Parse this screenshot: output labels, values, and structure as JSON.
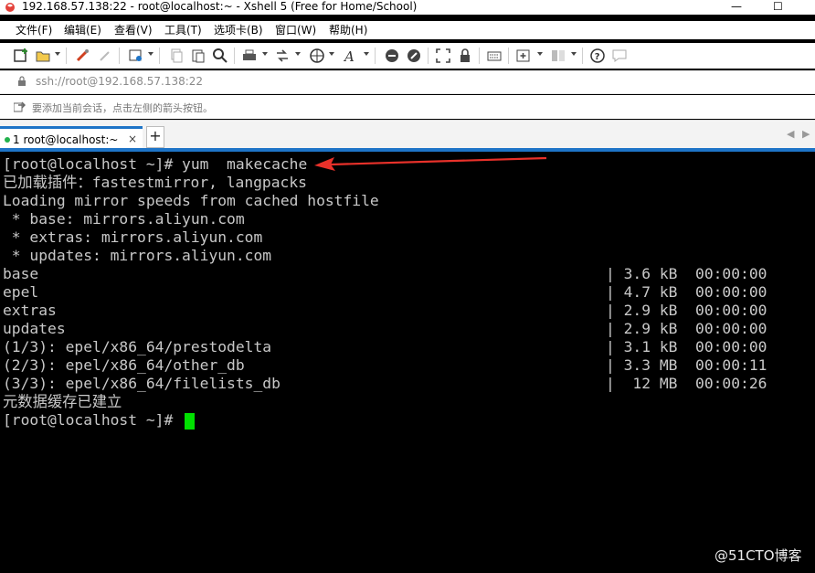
{
  "window": {
    "title": "192.168.57.138:22 - root@localhost:~ - Xshell 5 (Free for Home/School)",
    "min_symbol": "—",
    "max_symbol": "☐"
  },
  "menu": [
    "文件(F)",
    "编辑(E)",
    "查看(V)",
    "工具(T)",
    "选项卡(B)",
    "窗口(W)",
    "帮助(H)"
  ],
  "address": "ssh://root@192.168.57.138:22",
  "hint": "要添加当前会话，点击左侧的箭头按钮。",
  "tabs": {
    "active_label": "1 root@localhost:~",
    "close_symbol": "×",
    "add_symbol": "+",
    "nav_left": "◀",
    "nav_right": "▶"
  },
  "terminal": {
    "lines": [
      "[root@localhost ~]# yum  makecache",
      "已加载插件：fastestmirror, langpacks",
      "Loading mirror speeds from cached hostfile",
      " * base: mirrors.aliyun.com",
      " * extras: mirrors.aliyun.com",
      " * updates: mirrors.aliyun.com",
      "base",
      "epel",
      "extras",
      "updates",
      "(1/3): epel/x86_64/prestodelta",
      "(2/3): epel/x86_64/other_db",
      "(3/3): epel/x86_64/filelists_db",
      "元数据缓存已建立",
      "[root@localhost ~]# "
    ],
    "stats": [
      "| 3.6 kB  00:00:00",
      "| 4.7 kB  00:00:00",
      "| 2.9 kB  00:00:00",
      "| 2.9 kB  00:00:00",
      "| 3.1 kB  00:00:00",
      "| 3.3 MB  00:00:11",
      "|  12 MB  00:00:26"
    ]
  },
  "watermark": "@51CTO博客",
  "colors": {
    "accent": "#1e74c7",
    "terminal_bg": "#000000",
    "terminal_fg": "#c8c8c8",
    "cursor": "#00e000",
    "arrow": "#e8312a"
  }
}
